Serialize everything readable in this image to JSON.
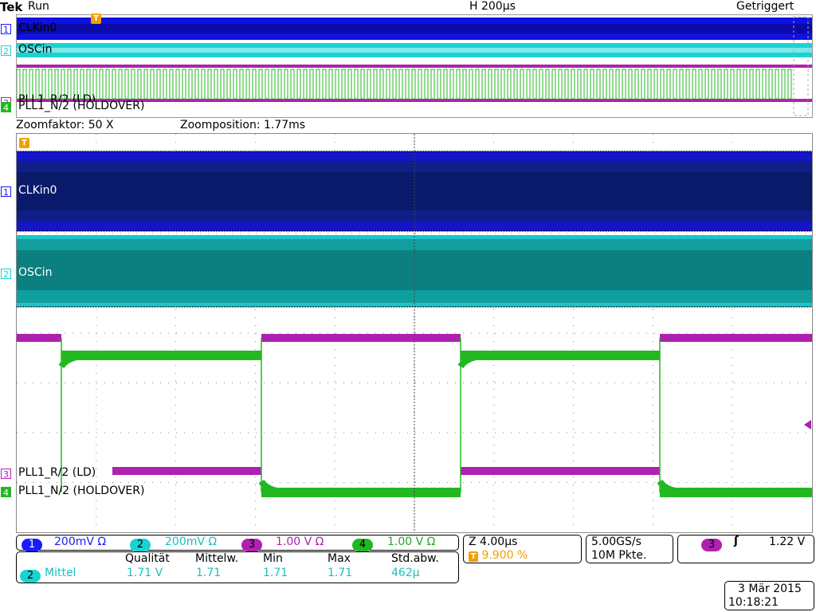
{
  "top_bar": {
    "brand": "Tek",
    "mode": "Run",
    "timebase": "H 200µs",
    "trigger_status": "Getriggert"
  },
  "zoom_info": {
    "factor": "Zoomfaktor: 50 X",
    "position": "Zoomposition: 1.77ms"
  },
  "overview_labels": {
    "ch1": "CLKin0",
    "ch2": "OSCin",
    "ch3": "PLL1_R/2 (LD)",
    "ch4": "PLL1_N/2 (HOLDOVER)"
  },
  "zoom_labels": {
    "ch1": "CLKin0",
    "ch2": "OSCin",
    "ch3": "PLL1_R/2 (LD)",
    "ch4": "PLL1_N/2 (HOLDOVER)"
  },
  "channel_numbers": {
    "ch1": "1",
    "ch2": "2",
    "ch3": "3",
    "ch4": "4",
    "trigger": "T"
  },
  "channel_scales": [
    {
      "num": "1",
      "scale": "200mV",
      "unit": "Ω",
      "color": "#1a1aff"
    },
    {
      "num": "2",
      "scale": "200mV",
      "unit": "Ω",
      "color": "#19d3d3"
    },
    {
      "num": "3",
      "scale": "1.00 V",
      "unit": "Ω",
      "color": "#b020b0"
    },
    {
      "num": "4",
      "scale": "1.00 V",
      "unit": "Ω",
      "color": "#22b822"
    }
  ],
  "measurement": {
    "headers": [
      "Qualität",
      "Mittelw.",
      "Min",
      "Max",
      "Std.abw."
    ],
    "source_channel": "2",
    "name": "Mittel",
    "values": [
      "1.71 V",
      "1.71",
      "1.71",
      "1.71",
      "462µ"
    ]
  },
  "zoom_box": {
    "time": "Z 4.00µs",
    "trigger_pos": "9.900 %"
  },
  "acquisition": {
    "rate": "5.00GS/s",
    "points": "10M Pkte."
  },
  "trigger": {
    "channel": "3",
    "slope": "ʃ",
    "level": "1.22 V"
  },
  "datetime": {
    "date": "3 Mär  2015",
    "time": "10:18:21"
  },
  "colors": {
    "ch1": "#1a1aff",
    "ch2": "#19d3d3",
    "ch3": "#b020b0",
    "ch4": "#22b822",
    "trigger": "#f0a000",
    "ch1_dark": "#0a1f6e",
    "ch2_dark": "#0c7f80"
  }
}
